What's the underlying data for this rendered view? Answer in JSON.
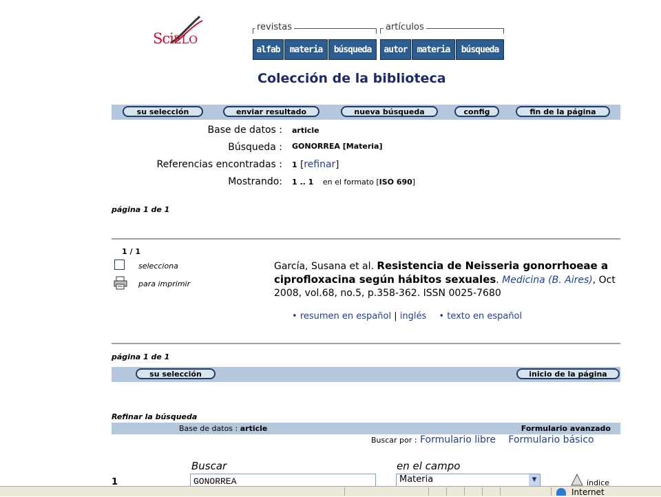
{
  "logo": {
    "part1": "Sci",
    "part2": "ELO"
  },
  "nav": {
    "revistas_label": "revistas",
    "articulos_label": "artículos",
    "revistas_buttons": [
      "alfab",
      "materia",
      "búsqueda"
    ],
    "articulos_buttons": [
      "autor",
      "materia",
      "búsqueda"
    ]
  },
  "title": "Colección de la biblioteca",
  "toolbar_top": [
    "su selección",
    "enviar resultado",
    "nueva búsqueda",
    "config",
    "fin de la página"
  ],
  "summary": {
    "db_label": "Base de datos :",
    "db_value": "article",
    "search_label": "Búsqueda :",
    "search_value": "GONORREA [Materia]",
    "refs_label": "Referencias encontradas :",
    "refs_value": "1",
    "refinar_link": "refinar",
    "showing_label": "Mostrando:",
    "showing_value": "1 .. 1",
    "format_text": "en el formato",
    "format_value": "ISO 690"
  },
  "page_info_top": "página 1 de 1",
  "result": {
    "counter": "1 / 1",
    "select_label": "selecciona",
    "print_label": "para imprimir",
    "authors": "García, Susana et al.",
    "title": "Resistencia de Neisseria gonorrhoeae a ciprofloxacina según hábitos sexuales",
    "journal": "Medicina (B. Aires)",
    "details": ", Oct 2008, vol.68, no.5, p.358-362. ISSN 0025-7680",
    "link_resumen": "resumen en español",
    "link_ingles": "inglés",
    "link_texto": "texto en español"
  },
  "page_info_bottom": "página 1 de 1",
  "toolbar_bottom": {
    "left": "su selección",
    "right": "inicio de la página"
  },
  "refine": {
    "heading": "Refinar la búsqueda",
    "db_label": "Base de datos :",
    "db_value": "article",
    "advanced": "Formulario avanzado",
    "search_by": "Buscar por :",
    "free_form": "Formulario libre",
    "basic_form": "Formulario básico",
    "buscar_label": "Buscar",
    "campo_label": "en el campo",
    "row_number": "1",
    "search_value": "GONORREA",
    "field_value": "Materia",
    "index_label": "índice"
  },
  "statusbar": {
    "zone": "Internet"
  },
  "colors": {
    "nav_button": "#2d5d8c",
    "bar": "#b5c7dd",
    "title": "#1b2a70",
    "link": "#1f3f99",
    "logo": "#c8102e"
  },
  "icons": [
    "checkbox-icon",
    "printer-icon",
    "globe-icon",
    "chevron-down-icon",
    "index-icon"
  ]
}
